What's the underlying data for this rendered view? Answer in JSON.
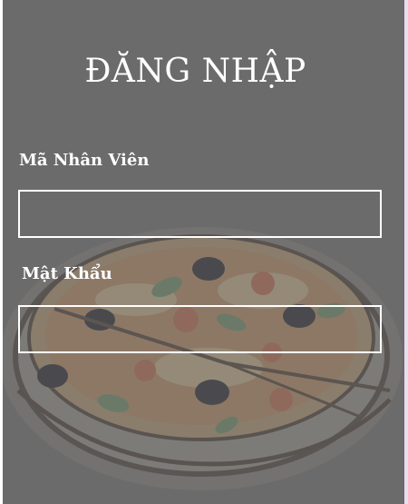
{
  "login": {
    "title": "ĐĂNG NHẬP",
    "employee_id": {
      "label": "Mã Nhân Viên",
      "value": "",
      "placeholder": ""
    },
    "password": {
      "label": "Mật Khẩu",
      "value": "",
      "placeholder": ""
    }
  },
  "background": {
    "image": "pizza-illustration",
    "overlay_color": "#6b6b6b"
  }
}
